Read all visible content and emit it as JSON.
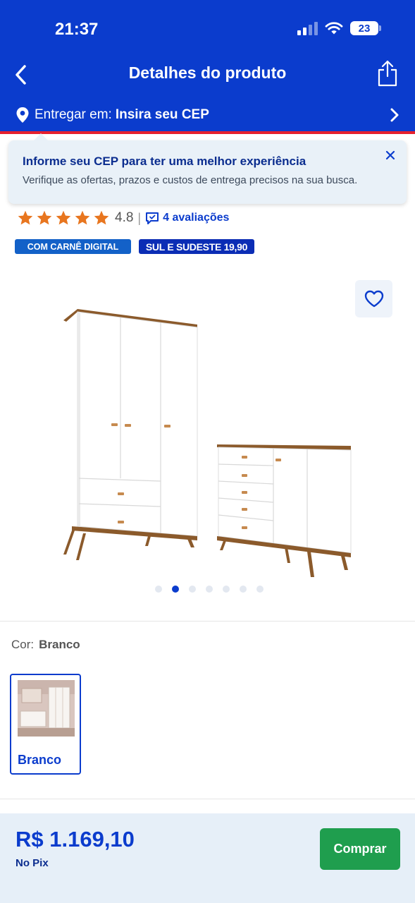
{
  "status_bar": {
    "time": "21:37",
    "battery": "23"
  },
  "header": {
    "title": "Detalhes do produto"
  },
  "delivery": {
    "label": "Entregar em:",
    "value": "Insira seu CEP"
  },
  "cep_tooltip": {
    "title": "Informe seu CEP para ter uma melhor experiência",
    "text": "Verifique as ofertas, prazos e custos de entrega precisos na sua busca."
  },
  "rating": {
    "stars": 5,
    "value": "4.8",
    "separator": "|",
    "reviews": "4 avaliações"
  },
  "badges": {
    "carne": "COM CARNÊ DIGITAL",
    "frete": "SUL E SUDESTE 19,90"
  },
  "gallery": {
    "total": 7,
    "active_index": 1
  },
  "variant": {
    "label": "Cor:",
    "selected": "Branco",
    "options": [
      "Branco"
    ]
  },
  "purchase": {
    "price": "R$ 1.169,10",
    "payment": "No Pix",
    "buy_label": "Comprar"
  },
  "colors": {
    "brand": "#0b3ccd",
    "accent_red": "#e5202e",
    "buy_green": "#1f9e4e",
    "star": "#e8761f"
  }
}
